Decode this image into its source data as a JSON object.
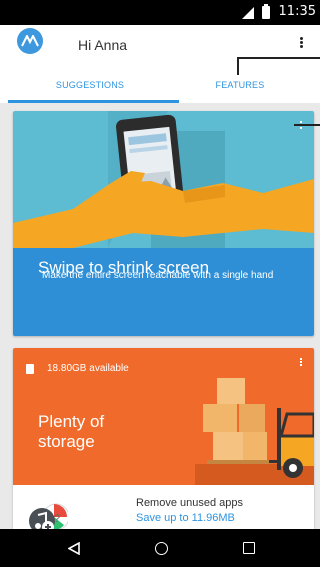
{
  "status_bar": {
    "time": "11:35",
    "icons": [
      "signal-icon",
      "battery-icon"
    ]
  },
  "header": {
    "greeting": "Hi Anna",
    "menu_icon": "more-vert-icon"
  },
  "tabs": [
    {
      "label": "SUGGESTIONS",
      "active": true
    },
    {
      "label": "FEATURES",
      "active": false
    }
  ],
  "cards": {
    "swipe": {
      "title": "Swipe to shrink screen",
      "description": "Make the entire screen reachable with a single hand"
    },
    "storage": {
      "available": "18.80GB available",
      "title": "Plenty of storage",
      "row_title": "Remove unused apps",
      "row_subtitle": "Save up to 11.96MB"
    }
  },
  "nav": {
    "icons": [
      "back-icon",
      "home-icon",
      "recent-apps-icon"
    ]
  },
  "colors": {
    "accent": "#2f94e0",
    "swipe_card": "#2f8fd6",
    "storage_card": "#f06b2b",
    "illustration_bg": "#5dbcd2"
  }
}
